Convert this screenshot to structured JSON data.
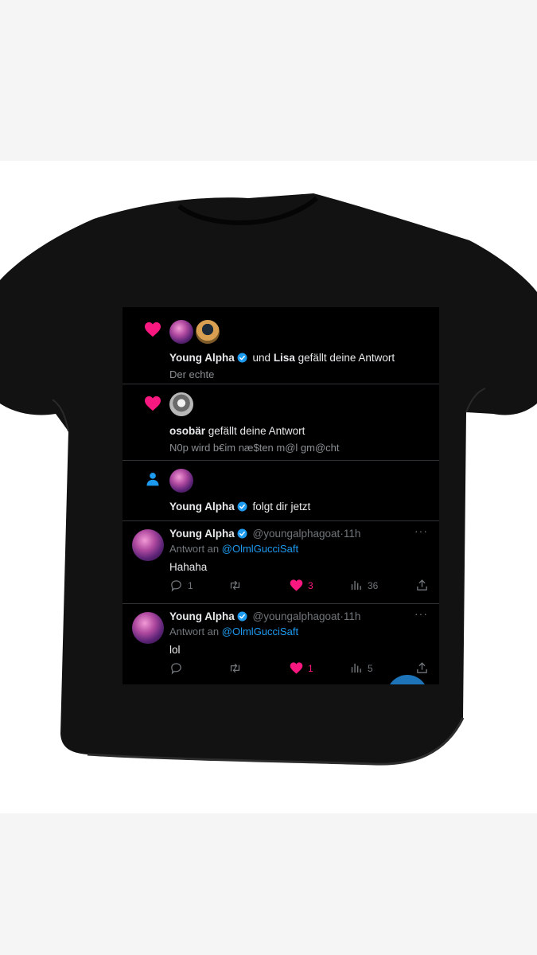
{
  "notifications": [
    {
      "type": "like",
      "icon": "heart-icon",
      "user1": "Young Alpha",
      "connector": "und",
      "user2": "Lisa",
      "action": "gefällt deine Antwort",
      "snippet": "Der echte"
    },
    {
      "type": "like",
      "icon": "heart-icon",
      "user1": "osobär",
      "action": "gefällt deine Antwort",
      "snippet": "N0p wird b€im næ$ten m@l gm@cht"
    },
    {
      "type": "follow",
      "icon": "person-icon",
      "user1": "Young Alpha",
      "action": "folgt dir jetzt"
    }
  ],
  "tweets": [
    {
      "name": "Young Alpha",
      "handle": "@youngalphagoat",
      "separator": "·",
      "time": "11h",
      "reply_prefix": "Antwort an",
      "reply_to": "@OlmlGucciSaft",
      "text": "Hahaha",
      "replies": "1",
      "retweets": "",
      "likes": "3",
      "views": "36"
    },
    {
      "name": "Young Alpha",
      "handle": "@youngalphagoat",
      "separator": "·",
      "time": "11h",
      "reply_prefix": "Antwort an",
      "reply_to": "@OlmlGucciSaft",
      "text": "lol",
      "replies": "",
      "retweets": "",
      "likes": "1",
      "views": "5"
    }
  ],
  "more_label": "···",
  "colors": {
    "background": "#000000",
    "like": "#f91880",
    "link": "#1d9bf0",
    "verified": "#1d9bf0",
    "muted": "#71767b",
    "shirt": "#121212"
  }
}
